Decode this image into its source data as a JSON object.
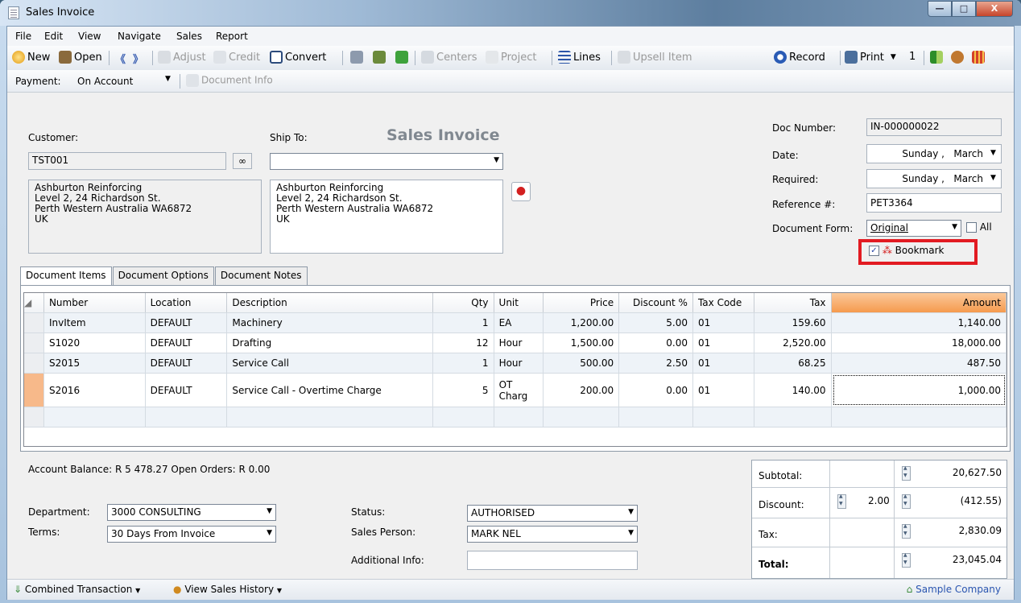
{
  "window": {
    "title": "Sales Invoice",
    "min": "—",
    "max": "□",
    "close": "X"
  },
  "menu": [
    "File",
    "Edit",
    "View",
    "Navigate",
    "Sales",
    "Report"
  ],
  "toolbar": {
    "new": "New",
    "open": "Open",
    "adjust": "Adjust",
    "credit": "Credit",
    "convert": "Convert",
    "centers": "Centers",
    "project": "Project",
    "lines": "Lines",
    "upsell": "Upsell Item",
    "record": "Record",
    "print": "Print",
    "print_copies": "1"
  },
  "payment": {
    "label": "Payment:",
    "value": "On Account",
    "doc_info": "Document Info"
  },
  "heading": "Sales Invoice",
  "customer": {
    "label": "Customer:",
    "code": "TST001",
    "address": [
      "Ashburton Reinforcing",
      "Level 2, 24 Richardson St.",
      "Perth  Western Australia  WA6872",
      "UK"
    ]
  },
  "ship_to": {
    "label": "Ship To:",
    "value": "",
    "address": [
      "Ashburton Reinforcing",
      "Level 2, 24 Richardson St.",
      "Perth  Western Australia  WA6872",
      "UK"
    ]
  },
  "doc": {
    "number_label": "Doc Number:",
    "number": "IN-000000022",
    "date_label": "Date:",
    "date_day": "Sunday",
    "date_month": "March",
    "required_label": "Required:",
    "required_day": "Sunday",
    "required_month": "March",
    "reference_label": "Reference #:",
    "reference": "PET3364",
    "form_label": "Document Form:",
    "form": "Original",
    "all_label": "All",
    "bookmark_label": "Bookmark"
  },
  "tabs": [
    "Document Items",
    "Document Options",
    "Document Notes"
  ],
  "grid": {
    "headers": [
      "Number",
      "Location",
      "Description",
      "Qty",
      "Unit",
      "Price",
      "Discount %",
      "Tax Code",
      "Tax",
      "Amount"
    ],
    "rows": [
      {
        "number": "InvItem",
        "location": "DEFAULT",
        "description": "Machinery",
        "qty": "1",
        "unit": "EA",
        "price": "1,200.00",
        "discount": "5.00",
        "tax_code": "01",
        "tax": "159.60",
        "amount": "1,140.00"
      },
      {
        "number": "S1020",
        "location": "DEFAULT",
        "description": "Drafting",
        "qty": "12",
        "unit": "Hour",
        "price": "1,500.00",
        "discount": "0.00",
        "tax_code": "01",
        "tax": "2,520.00",
        "amount": "18,000.00"
      },
      {
        "number": "S2015",
        "location": "DEFAULT",
        "description": "Service Call",
        "qty": "1",
        "unit": "Hour",
        "price": "500.00",
        "discount": "2.50",
        "tax_code": "01",
        "tax": "68.25",
        "amount": "487.50"
      },
      {
        "number": "S2016",
        "location": "DEFAULT",
        "description": "Service Call - Overtime Charge",
        "qty": "5",
        "unit": "OT Charg",
        "price": "200.00",
        "discount": "0.00",
        "tax_code": "01",
        "tax": "140.00",
        "amount": "1,000.00"
      }
    ]
  },
  "footer": {
    "balance": "Account Balance: R 5 478.27  Open Orders: R 0.00",
    "department_label": "Department:",
    "department": "3000 CONSULTING",
    "terms_label": "Terms:",
    "terms": "30 Days From Invoice",
    "status_label": "Status:",
    "status": "AUTHORISED",
    "salesperson_label": "Sales Person:",
    "salesperson": "MARK NEL",
    "additional_label": "Additional Info:",
    "additional": ""
  },
  "totals": {
    "subtotal_label": "Subtotal:",
    "subtotal": "20,627.50",
    "discount_label": "Discount:",
    "discount_pct": "2.00",
    "discount": "(412.55)",
    "tax_label": "Tax:",
    "tax": "2,830.09",
    "total_label": "Total:",
    "total": "23,045.04"
  },
  "status": {
    "combined": "Combined Transaction",
    "history": "View Sales History",
    "company": "Sample Company"
  },
  "colors": {
    "highlight": "#e21b22",
    "amount_header": "#f6a25a"
  }
}
